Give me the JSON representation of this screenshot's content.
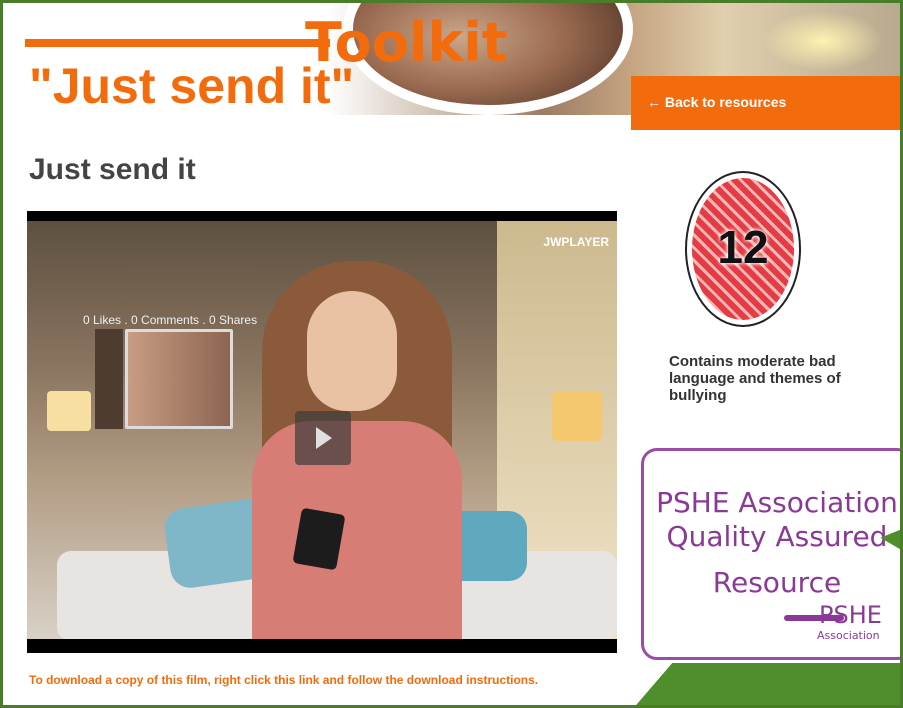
{
  "header": {
    "toolkit_title": "Toolkit",
    "banner_title": "\"Just send it\"",
    "back_link": "← Back to resources"
  },
  "main": {
    "page_title": "Just send it",
    "video": {
      "player_brand": "JWPLAYER",
      "social_counts": "0 Likes . 0 Comments . 0 Shares"
    },
    "download_text": "To download a copy of this film, right click this link and follow the download instructions."
  },
  "sidebar": {
    "rating": {
      "value": "12",
      "description": "Contains moderate bad language and themes of bullying"
    },
    "pshe": {
      "line1": "PSHE Association",
      "line2": "Quality Assured",
      "line3": "Resource",
      "logo": "PSHE",
      "logo_sub": "Association"
    }
  },
  "colors": {
    "accent_orange": "#f26c0d",
    "pshe_purple": "#8a3a96",
    "green": "#4e8f2c"
  }
}
